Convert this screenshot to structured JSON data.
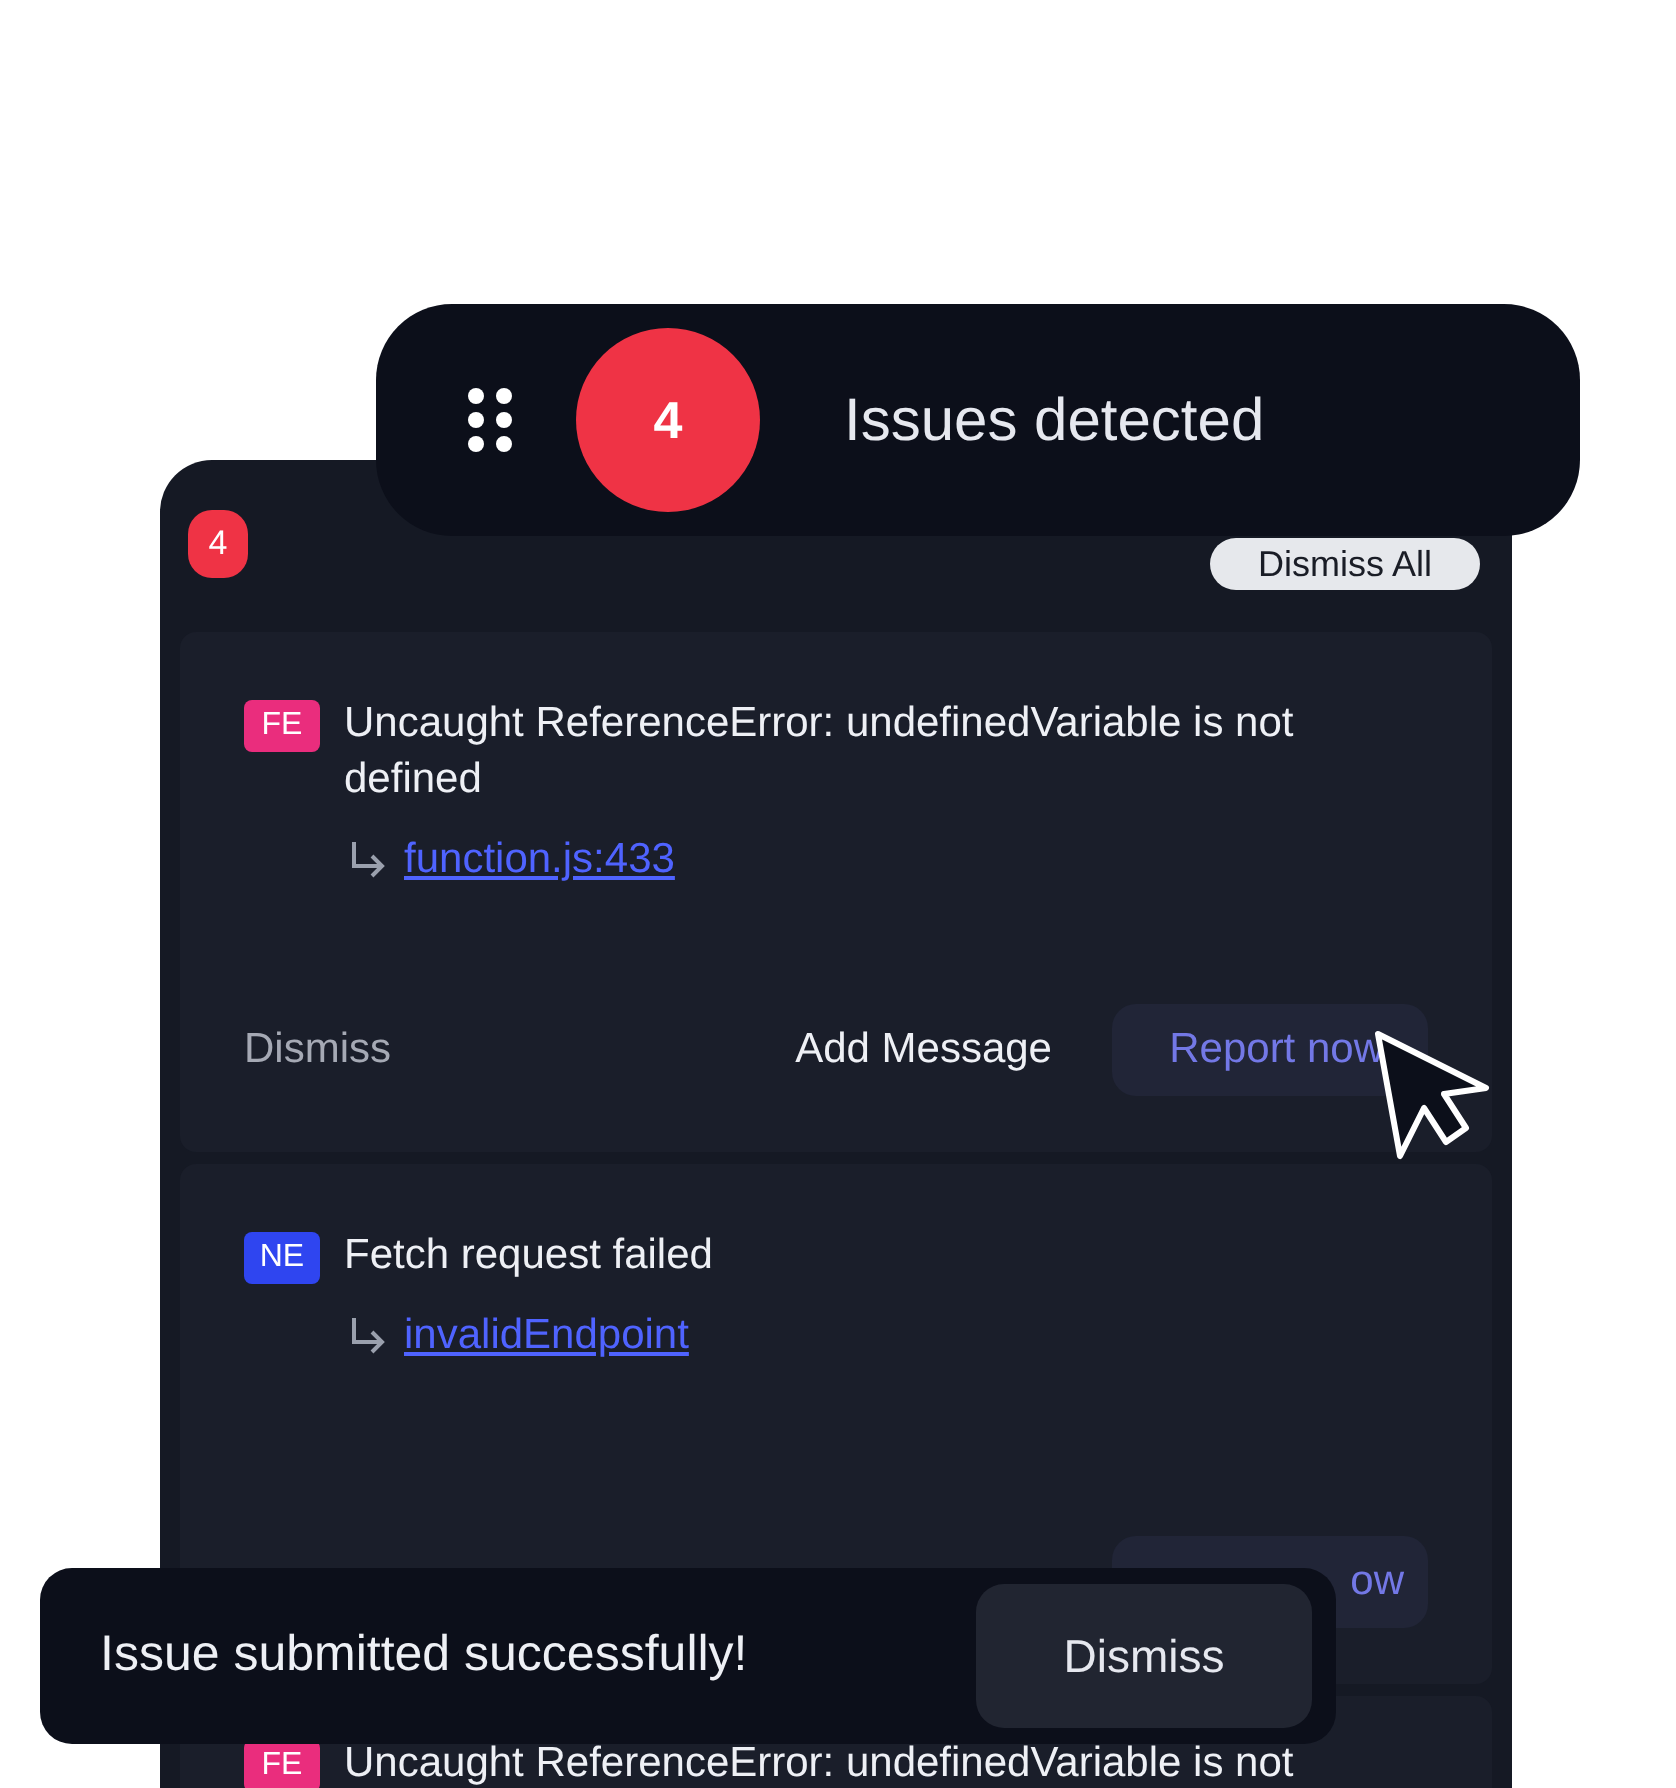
{
  "summary_pill": {
    "count": "4",
    "title": "Issues detected"
  },
  "panel": {
    "count": "4",
    "dismiss_all": "Dismiss All"
  },
  "issues": [
    {
      "tag": "FE",
      "color": "#ea2d7d",
      "message": "Uncaught ReferenceError: undefinedVariable is not defined",
      "source": "function.js:433",
      "dismiss": "Dismiss",
      "add_message": "Add Message",
      "report": "Report now"
    },
    {
      "tag": "NE",
      "color": "#2f45f0",
      "message": "Fetch request failed",
      "source": "invalidEndpoint",
      "report": "ow"
    },
    {
      "tag": "FE",
      "color": "#ea2d7d",
      "message": "Uncaught ReferenceError: undefinedVariable is not"
    }
  ],
  "toast": {
    "message": "Issue submitted successfully!",
    "dismiss": "Dismiss"
  }
}
